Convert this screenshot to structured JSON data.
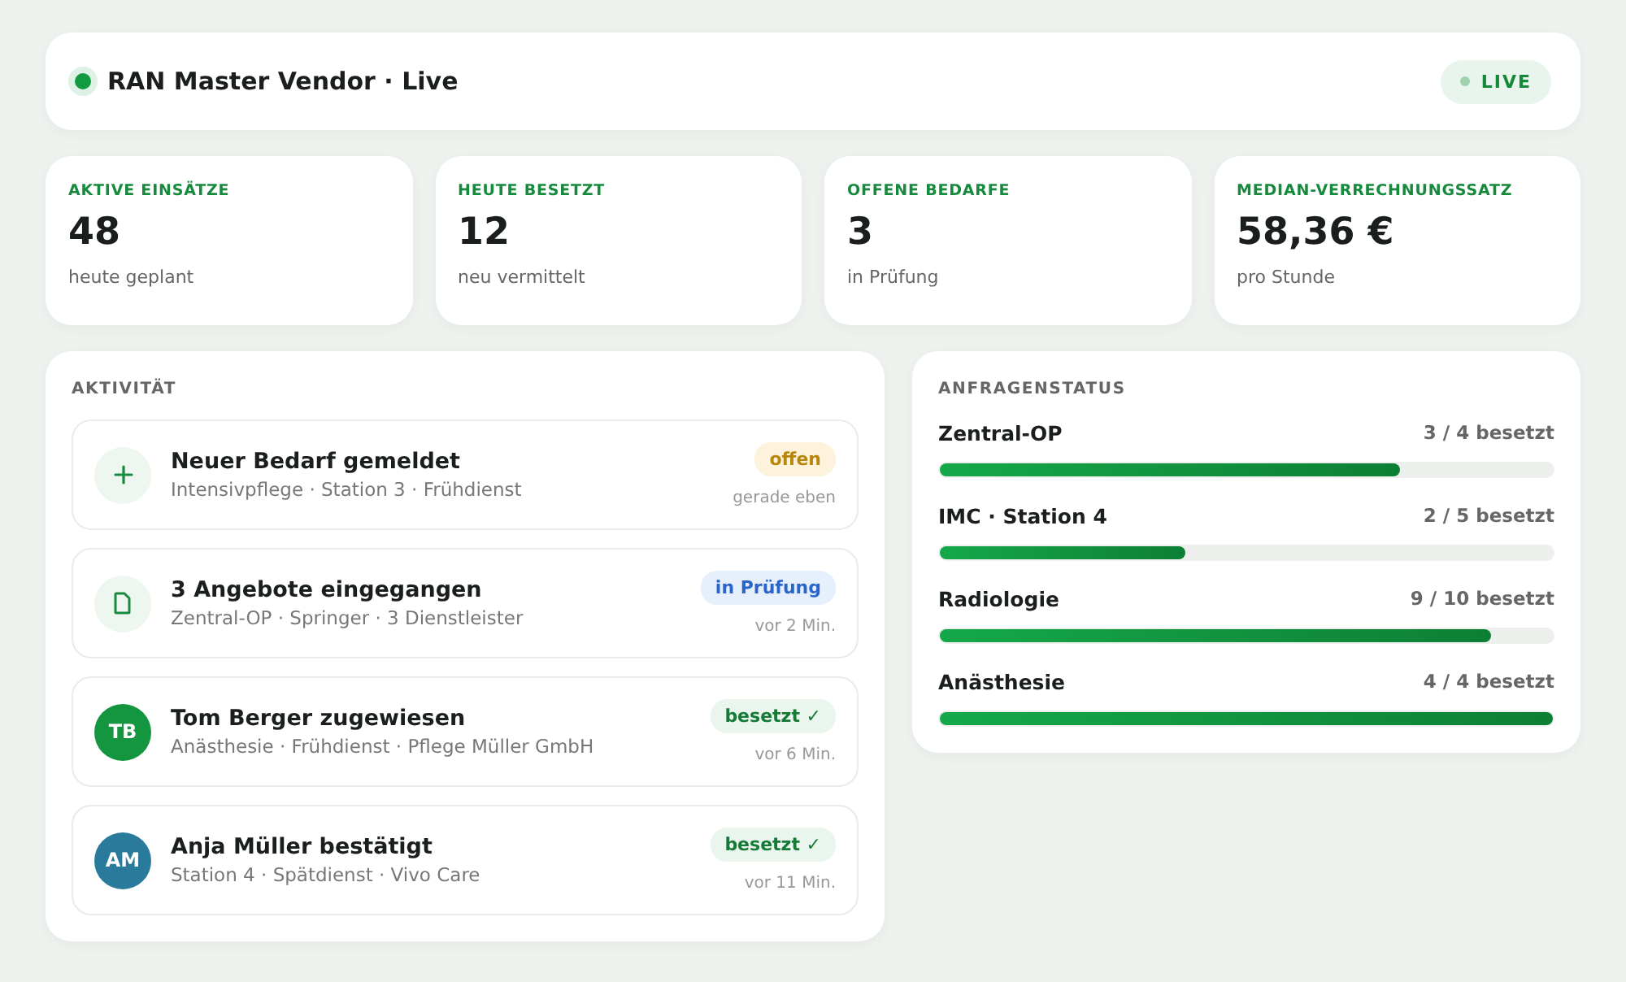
{
  "header": {
    "title": "RAN Master Vendor · Live",
    "badge": "LIVE"
  },
  "stats": [
    {
      "label": "AKTIVE EINSÄTZE",
      "value": "48",
      "caption": "heute geplant"
    },
    {
      "label": "HEUTE BESETZT",
      "value": "12",
      "caption": "neu vermittelt"
    },
    {
      "label": "OFFENE BEDARFE",
      "value": "3",
      "caption": "in Prüfung"
    },
    {
      "label": "MEDIAN-VERRECHNUNGSSATZ",
      "value": "58,36 €",
      "caption": "pro Stunde"
    }
  ],
  "activity": {
    "title": "AKTIVITÄT",
    "items": [
      {
        "kind": "plus",
        "title": "Neuer Bedarf gemeldet",
        "detail": "Intensivpflege · Station 3 · Frühdienst",
        "status": {
          "kind": "open",
          "label": "offen"
        },
        "time": "gerade eben"
      },
      {
        "kind": "document",
        "title": "3 Angebote eingegangen",
        "detail": "Zentral-OP · Springer · 3 Dienstleister",
        "status": {
          "kind": "review",
          "label": "in Prüfung"
        },
        "time": "vor 2 Min."
      },
      {
        "kind": "avatar",
        "initials": "TB",
        "color": "#14953f",
        "title": "Tom Berger zugewiesen",
        "detail": "Anästhesie · Frühdienst · Pflege Müller GmbH",
        "status": {
          "kind": "filled",
          "label": "besetzt ✓"
        },
        "time": "vor 6 Min."
      },
      {
        "kind": "avatar",
        "initials": "AM",
        "color": "#2a7a9c",
        "title": "Anja Müller bestätigt",
        "detail": "Station 4 · Spätdienst · Vivo Care",
        "status": {
          "kind": "filled",
          "label": "besetzt ✓"
        },
        "time": "vor 11 Min."
      }
    ]
  },
  "request_status": {
    "title": "ANFRAGENSTATUS",
    "rows": [
      {
        "name": "Zentral-OP",
        "reading": "3 / 4 besetzt",
        "level": 0.75
      },
      {
        "name": "IMC · Station 4",
        "reading": "2 / 5 besetzt",
        "level": 0.4
      },
      {
        "name": "Radiologie",
        "reading": "9 / 10 besetzt",
        "level": 0.9
      },
      {
        "name": "Anästhesie",
        "reading": "4 / 4 besetzt",
        "level": 1
      }
    ]
  }
}
